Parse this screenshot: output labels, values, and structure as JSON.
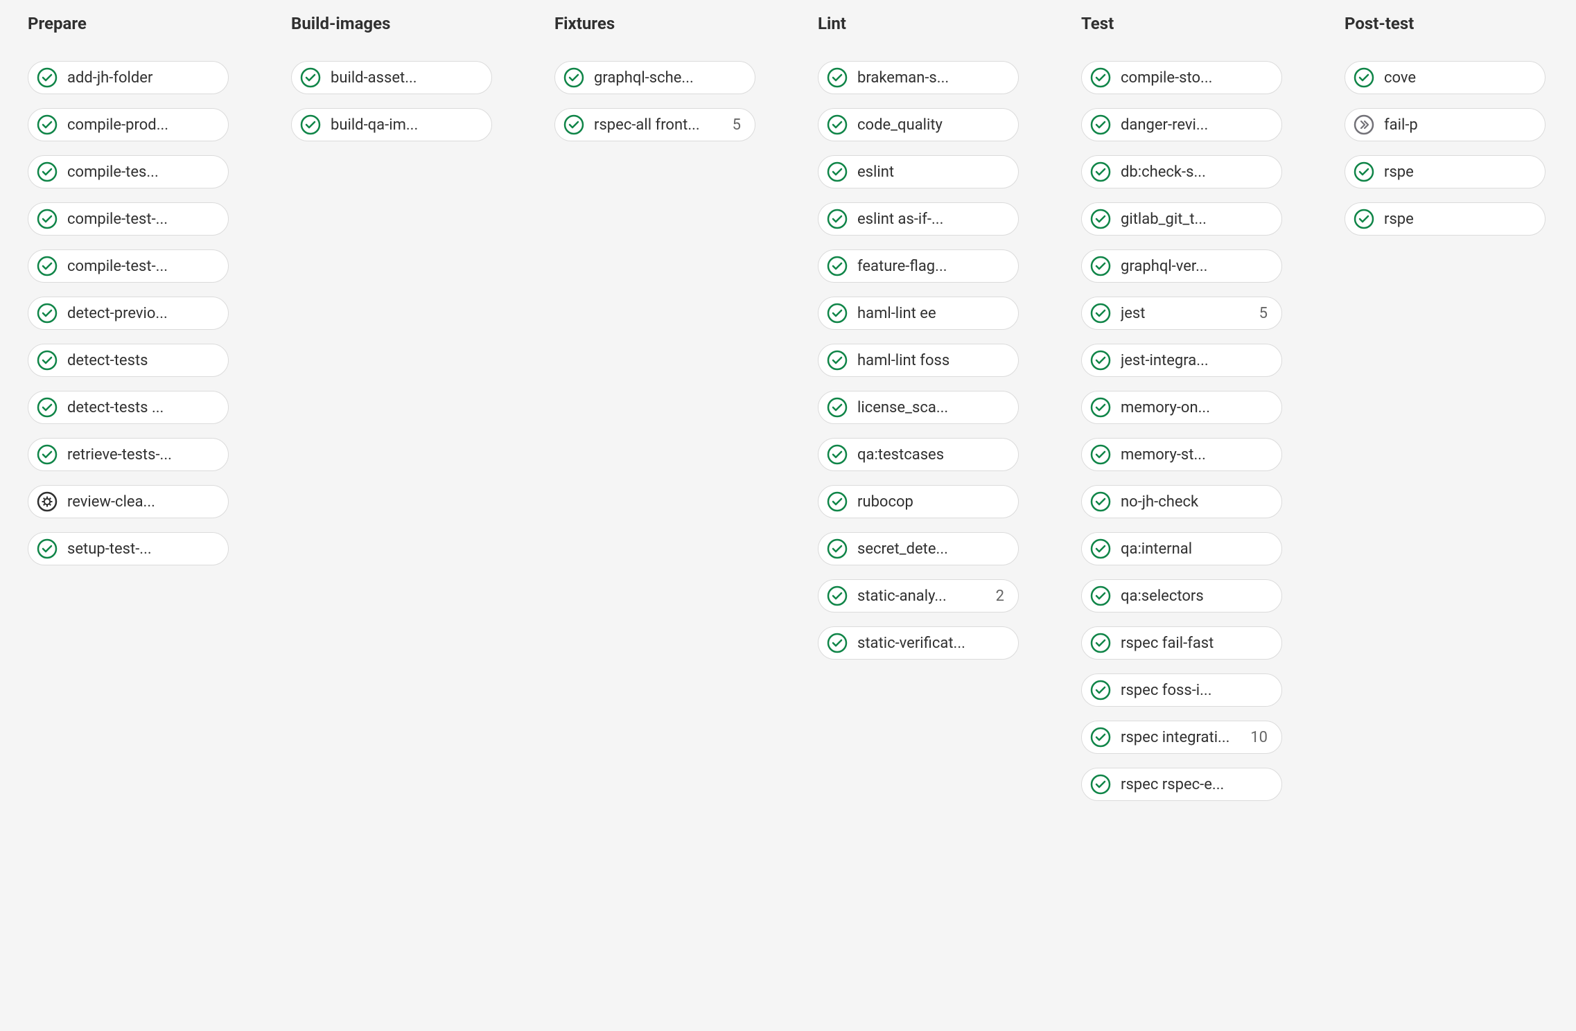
{
  "stages": [
    {
      "name": "Prepare",
      "jobs": [
        {
          "label": "add-jh-folder",
          "status": "passed"
        },
        {
          "label": "compile-prod...",
          "status": "passed"
        },
        {
          "label": "compile-tes...",
          "status": "passed"
        },
        {
          "label": "compile-test-...",
          "status": "passed"
        },
        {
          "label": "compile-test-...",
          "status": "passed"
        },
        {
          "label": "detect-previo...",
          "status": "passed"
        },
        {
          "label": "detect-tests",
          "status": "passed"
        },
        {
          "label": "detect-tests ...",
          "status": "passed"
        },
        {
          "label": "retrieve-tests-...",
          "status": "passed"
        },
        {
          "label": "review-clea...",
          "status": "manual"
        },
        {
          "label": "setup-test-...",
          "status": "passed"
        }
      ]
    },
    {
      "name": "Build-images",
      "jobs": [
        {
          "label": "build-asset...",
          "status": "passed"
        },
        {
          "label": "build-qa-im...",
          "status": "passed"
        }
      ]
    },
    {
      "name": "Fixtures",
      "jobs": [
        {
          "label": "graphql-sche...",
          "status": "passed"
        },
        {
          "label": "rspec-all front...",
          "status": "passed",
          "count": "5"
        }
      ]
    },
    {
      "name": "Lint",
      "jobs": [
        {
          "label": "brakeman-s...",
          "status": "passed"
        },
        {
          "label": "code_quality",
          "status": "passed"
        },
        {
          "label": "eslint",
          "status": "passed"
        },
        {
          "label": "eslint as-if-...",
          "status": "passed"
        },
        {
          "label": "feature-flag...",
          "status": "passed"
        },
        {
          "label": "haml-lint ee",
          "status": "passed"
        },
        {
          "label": "haml-lint foss",
          "status": "passed"
        },
        {
          "label": "license_sca...",
          "status": "passed"
        },
        {
          "label": "qa:testcases",
          "status": "passed"
        },
        {
          "label": "rubocop",
          "status": "passed"
        },
        {
          "label": "secret_dete...",
          "status": "passed"
        },
        {
          "label": "static-analy...",
          "status": "passed",
          "count": "2"
        },
        {
          "label": "static-verificat...",
          "status": "passed"
        }
      ]
    },
    {
      "name": "Test",
      "jobs": [
        {
          "label": "compile-sto...",
          "status": "passed"
        },
        {
          "label": "danger-revi...",
          "status": "passed"
        },
        {
          "label": "db:check-s...",
          "status": "passed"
        },
        {
          "label": "gitlab_git_t...",
          "status": "passed"
        },
        {
          "label": "graphql-ver...",
          "status": "passed"
        },
        {
          "label": "jest",
          "status": "passed",
          "count": "5"
        },
        {
          "label": "jest-integra...",
          "status": "passed"
        },
        {
          "label": "memory-on...",
          "status": "passed"
        },
        {
          "label": "memory-st...",
          "status": "passed"
        },
        {
          "label": "no-jh-check",
          "status": "passed"
        },
        {
          "label": "qa:internal",
          "status": "passed"
        },
        {
          "label": "qa:selectors",
          "status": "passed"
        },
        {
          "label": "rspec fail-fast",
          "status": "passed"
        },
        {
          "label": "rspec foss-i...",
          "status": "passed"
        },
        {
          "label": "rspec integrati...",
          "status": "passed",
          "count": "10"
        },
        {
          "label": "rspec rspec-e...",
          "status": "passed"
        }
      ]
    },
    {
      "name": "Post-test",
      "jobs": [
        {
          "label": "cove",
          "status": "passed"
        },
        {
          "label": "fail-p",
          "status": "skipped"
        },
        {
          "label": "rspe",
          "status": "passed"
        },
        {
          "label": "rspe",
          "status": "passed"
        }
      ]
    }
  ]
}
